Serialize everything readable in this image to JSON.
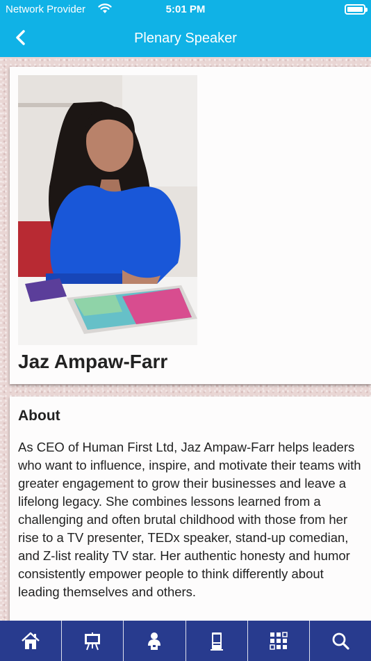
{
  "status_bar": {
    "carrier": "Network Provider",
    "time": "5:01 PM"
  },
  "header": {
    "title": "Plenary Speaker",
    "background_color": "#10b2e6"
  },
  "speaker": {
    "name": "Jaz Ampaw-Farr"
  },
  "about": {
    "heading": "About",
    "text": "As CEO of Human First Ltd, Jaz Ampaw-Farr helps leaders who want to influence, inspire, and motivate their teams with greater engagement to grow their businesses and leave a lifelong legacy. She combines lessons learned from a challenging and often brutal childhood with those from her rise to a TV presenter, TEDx speaker, stand-up comedian, and Z-list reality TV star. Her authentic honesty and humor consistently empower people to think differently about leading themselves and others."
  },
  "tabbar": {
    "background_color": "#283b8e",
    "tabs": [
      {
        "icon": "home-icon"
      },
      {
        "icon": "presentation-icon"
      },
      {
        "icon": "speaker-icon"
      },
      {
        "icon": "exhibitor-icon"
      },
      {
        "icon": "grid-menu-icon"
      },
      {
        "icon": "search-icon"
      }
    ]
  }
}
